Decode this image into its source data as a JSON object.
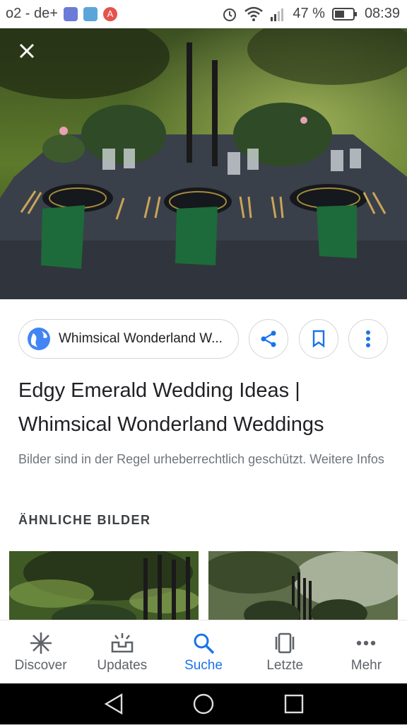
{
  "status_bar": {
    "carrier": "o2 - de+",
    "battery": "47 %",
    "time": "08:39",
    "notification_icons": [
      "gallery-icon",
      "photos-icon",
      "a-icon"
    ]
  },
  "source": {
    "name": "Whimsical Wonderland W..."
  },
  "title": "Edgy Emerald Wedding Ideas | Whimsical Wonderland Weddings",
  "copyright": "Bilder sind in der Regel urheberrechtlich geschützt. Weitere Infos",
  "section_heading": "ÄHNLICHE BILDER",
  "bottom_nav": [
    {
      "label": "Discover",
      "icon": "asterisk-icon",
      "active": false
    },
    {
      "label": "Updates",
      "icon": "updates-icon",
      "active": false
    },
    {
      "label": "Suche",
      "icon": "search-icon",
      "active": true
    },
    {
      "label": "Letzte",
      "icon": "recent-icon",
      "active": false
    },
    {
      "label": "Mehr",
      "icon": "more-icon",
      "active": false
    }
  ],
  "colors": {
    "accent": "#1a73e8",
    "napkin": "#1d6b3a",
    "tablecloth": "#3a4049"
  }
}
